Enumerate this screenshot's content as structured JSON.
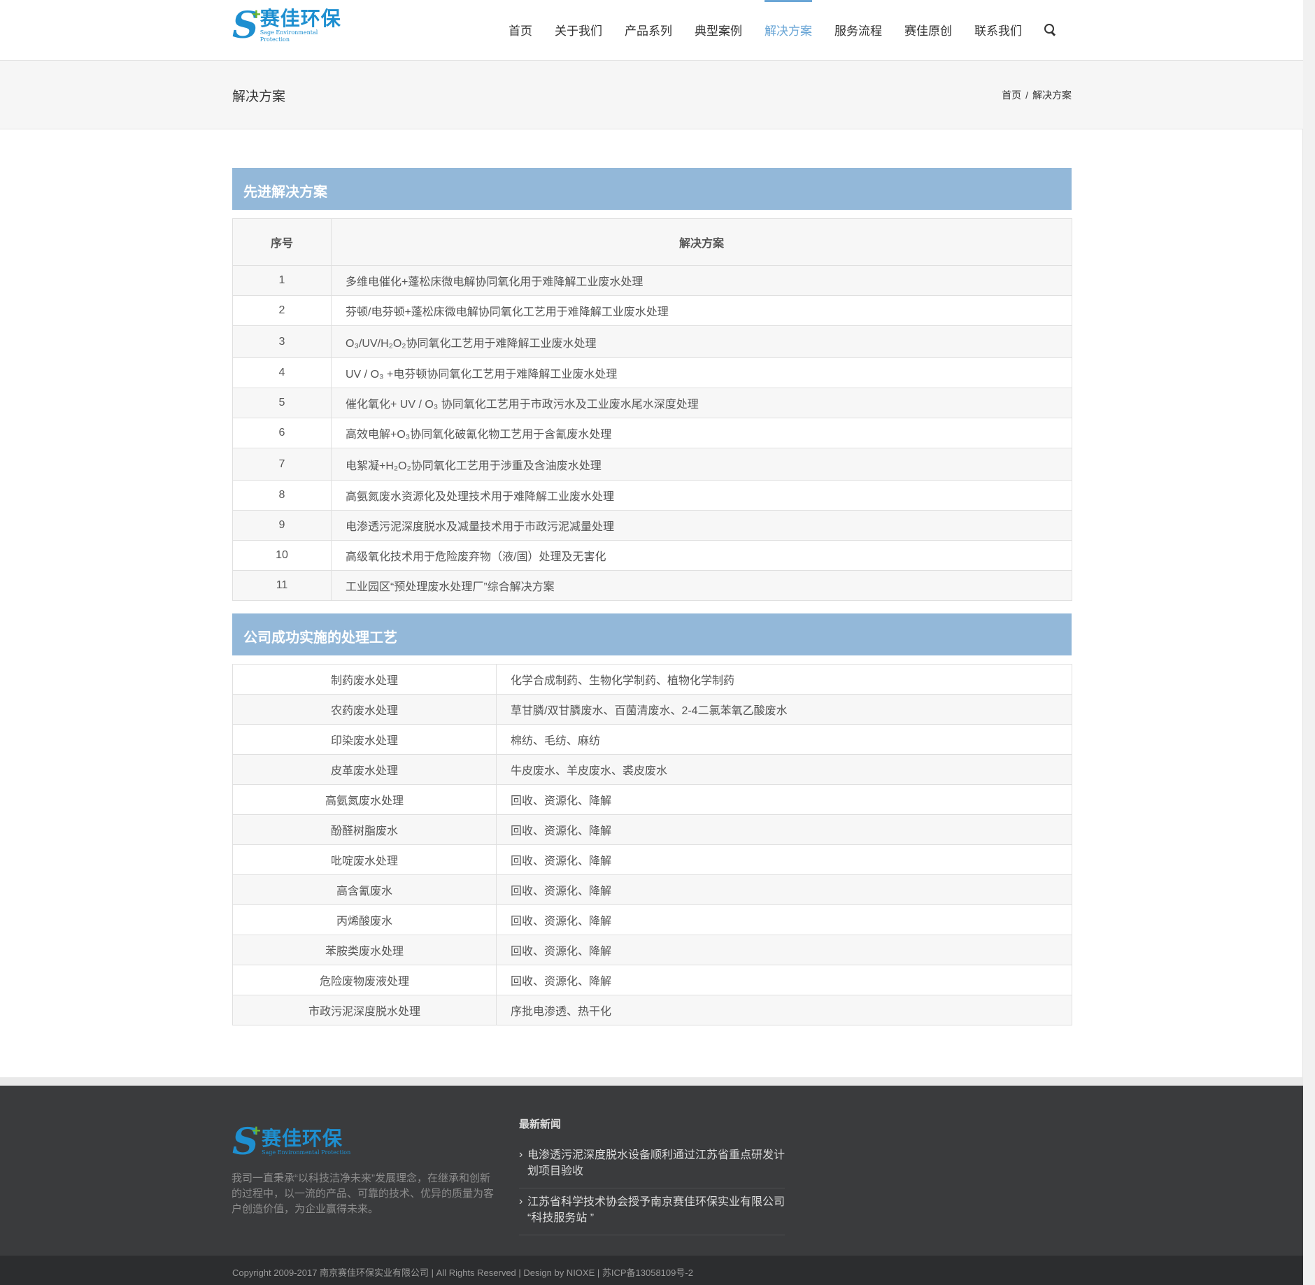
{
  "header": {
    "logo_cn": "赛佳环保",
    "logo_en": "Sage Environmental Protection",
    "nav": [
      "首页",
      "关于我们",
      "产品系列",
      "典型案例",
      "解决方案",
      "服务流程",
      "赛佳原创",
      "联系我们"
    ],
    "active_nav_index": 4
  },
  "titlebar": {
    "page_title": "解决方案",
    "breadcrumb": [
      "首页",
      "解决方案"
    ],
    "breadcrumb_sep": "/"
  },
  "section1": {
    "title": "先进解决方案",
    "col_no": "序号",
    "col_solution": "解决方案",
    "rows": [
      {
        "no": "1",
        "text": "多维电催化+蓬松床微电解协同氧化用于难降解工业废水处理"
      },
      {
        "no": "2",
        "text": "芬顿/电芬顿+蓬松床微电解协同氧化工艺用于难降解工业废水处理"
      },
      {
        "no": "3",
        "text": "O₃/UV/H₂O₂协同氧化工艺用于难降解工业废水处理"
      },
      {
        "no": "4",
        "text": "UV / O₃ +电芬顿协同氧化工艺用于难降解工业废水处理"
      },
      {
        "no": "5",
        "text": "催化氧化+ UV / O₃ 协同氧化工艺用于市政污水及工业废水尾水深度处理"
      },
      {
        "no": "6",
        "text": "高效电解+O₃协同氧化破氰化物工艺用于含氰废水处理"
      },
      {
        "no": "7",
        "text": "电絮凝+H₂O₂协同氧化工艺用于涉重及含油废水处理"
      },
      {
        "no": "8",
        "text": "高氨氮废水资源化及处理技术用于难降解工业废水处理"
      },
      {
        "no": "9",
        "text": "电渗透污泥深度脱水及减量技术用于市政污泥减量处理"
      },
      {
        "no": "10",
        "text": "高级氧化技术用于危险废弃物（液/固）处理及无害化"
      },
      {
        "no": "11",
        "text": "工业园区“预处理废水处理厂”综合解决方案"
      }
    ]
  },
  "section2": {
    "title": "公司成功实施的处理工艺",
    "rows": [
      {
        "cat": "制药废水处理",
        "desc": "化学合成制药、生物化学制药、植物化学制药"
      },
      {
        "cat": "农药废水处理",
        "desc": "草甘膦/双甘膦废水、百菌清废水、2-4二氯苯氧乙酸废水"
      },
      {
        "cat": "印染废水处理",
        "desc": "棉纺、毛纺、麻纺"
      },
      {
        "cat": "皮革废水处理",
        "desc": "牛皮废水、羊皮废水、裘皮废水"
      },
      {
        "cat": "高氨氮废水处理",
        "desc": "回收、资源化、降解"
      },
      {
        "cat": "酚醛树脂废水",
        "desc": "回收、资源化、降解"
      },
      {
        "cat": "吡啶废水处理",
        "desc": "回收、资源化、降解"
      },
      {
        "cat": "高含氰废水",
        "desc": "回收、资源化、降解"
      },
      {
        "cat": "丙烯酸废水",
        "desc": "回收、资源化、降解"
      },
      {
        "cat": "苯胺类废水处理",
        "desc": "回收、资源化、降解"
      },
      {
        "cat": "危险废物废液处理",
        "desc": "回收、资源化、降解"
      },
      {
        "cat": "市政污泥深度脱水处理",
        "desc": "序批电渗透、热干化"
      }
    ]
  },
  "footer": {
    "description": "我司一直秉承“以科技洁净未来”发展理念，在继承和创新的过程中，以一流的产品、可靠的技术、优异的质量为客户创造价值，为企业赢得未来。",
    "news_title": "最新新闻",
    "news": [
      "电渗透污泥深度脱水设备顺利通过江苏省重点研发计划项目验收",
      "江苏省科学技术协会授予南京赛佳环保实业有限公司 “科技服务站 ”"
    ],
    "copyright": "Copyright 2009-2017 南京赛佳环保实业有限公司 | All Rights Reserved | Design by NIOXE | 苏ICP备13058109号-2"
  },
  "colors": {
    "accent": "#6aa6d6",
    "section_head": "#93b8d9",
    "logo_blue": "#1e8fd0",
    "logo_green": "#6bb52f",
    "footer_bg": "#3a3b3d"
  }
}
